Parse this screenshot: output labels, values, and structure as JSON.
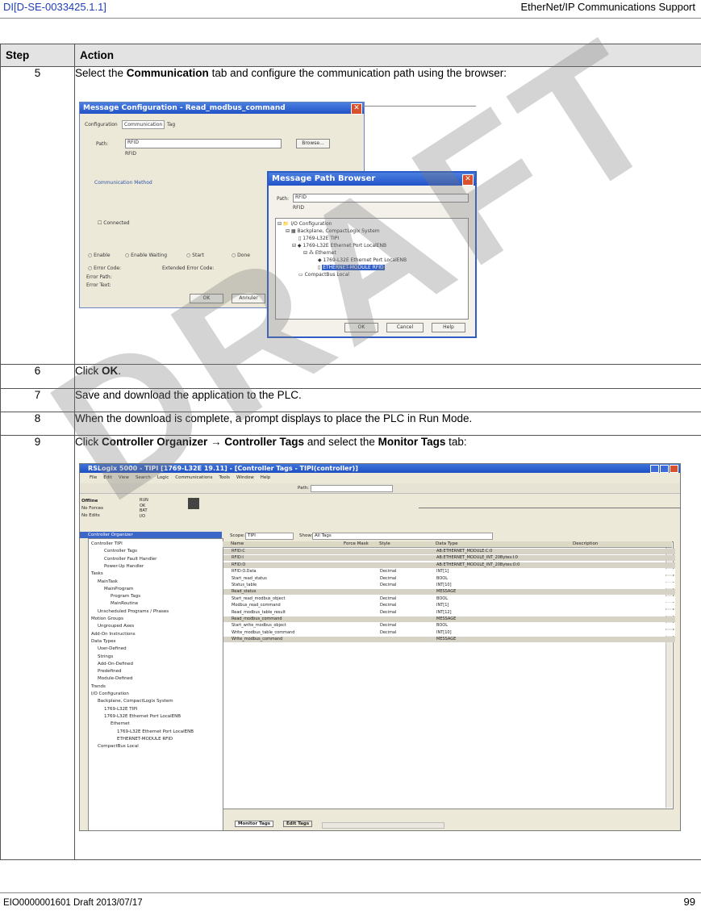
{
  "header": {
    "doc_id": "DI[D-SE-0033425.1.1]",
    "doc_title": "EtherNet/IP Communications Support"
  },
  "table": {
    "col_step": "Step",
    "col_action": "Action",
    "rows": [
      {
        "step": "5",
        "pre": "Select the ",
        "bold1": "Communication",
        "mid": " tab and configure the communication path using the browser:",
        "bold2": "",
        "post": "",
        "bold3": "",
        "post2": ""
      },
      {
        "step": "6",
        "pre": "Click ",
        "bold1": "OK",
        "mid": ".",
        "bold2": "",
        "post": "",
        "bold3": "",
        "post2": ""
      },
      {
        "step": "7",
        "pre": "Save and download the application to the PLC.",
        "bold1": "",
        "mid": "",
        "bold2": "",
        "post": "",
        "bold3": "",
        "post2": ""
      },
      {
        "step": "8",
        "pre": "When the download is complete, a prompt displays to place the PLC in Run Mode.",
        "bold1": "",
        "mid": "",
        "bold2": "",
        "post": "",
        "bold3": "",
        "post2": ""
      },
      {
        "step": "9",
        "pre": "Click ",
        "bold1": "Controller Organizer",
        "mid": " → ",
        "bold2": "Controller Tags",
        "post": " and select the ",
        "bold3": "Monitor Tags",
        "post2": " tab:"
      }
    ]
  },
  "msg_config": {
    "title": "Message Configuration - Read_modbus_command",
    "tabs": [
      "Configuration",
      "Communication",
      "Tag"
    ],
    "path_label": "Path:",
    "path_value": "RFID",
    "path_sub": "RFID",
    "browse": "Browse...",
    "comm_method": "Communication Method",
    "connected": "Connected",
    "status": [
      "Enable",
      "Enable Waiting",
      "Start",
      "Done"
    ],
    "error_code": "Error Code:",
    "extended_error": "Extended Error Code:",
    "error_path": "Error Path:",
    "error_text": "Error Text:",
    "ok": "OK",
    "annuler": "Annuler"
  },
  "path_browser": {
    "title": "Message Path Browser",
    "path_label": "Path:",
    "path_value": "RFID",
    "path_sub": "RFID",
    "tree": [
      "I/O Configuration",
      "Backplane, CompactLogix System",
      "1769-L32E TIPI",
      "1769-L32E Ethernet Port LocalENB",
      "Ethernet",
      "1769-L32E Ethernet Port LocalENB",
      "ETHERNET-MODULE RFID",
      "CompactBus Local"
    ],
    "ok": "OK",
    "cancel": "Cancel",
    "help": "Help"
  },
  "rslogix": {
    "title": "RSLogix 5000 - TIPI [1769-L32E 19.11] - [Controller Tags - TIPI(controller)]",
    "menu": [
      "File",
      "Edit",
      "View",
      "Search",
      "Logic",
      "Communications",
      "Tools",
      "Window",
      "Help"
    ],
    "status": [
      "Offline",
      "No Forces",
      "No Edits"
    ],
    "leds": [
      "RUN",
      "OK",
      "BAT",
      "I/O"
    ],
    "path_label": "Path:",
    "scope_label": "Scope:",
    "scope_value": "TIPI",
    "show_label": "Show:",
    "show_value": "All Tags",
    "organizer_title": "Controller Organizer",
    "tree": [
      "Controller TIPI",
      "Controller Tags",
      "Controller Fault Handler",
      "Power-Up Handler",
      "Tasks",
      "MainTask",
      "MainProgram",
      "Program Tags",
      "MainRoutine",
      "Unscheduled Programs / Phases",
      "Motion Groups",
      "Ungrouped Axes",
      "Add-On Instructions",
      "Data Types",
      "User-Defined",
      "Strings",
      "Add-On-Defined",
      "Predefined",
      "Module-Defined",
      "Trends",
      "I/O Configuration",
      "Backplane, CompactLogix System",
      "1769-L32E TIPI",
      "1769-L32E Ethernet Port LocalENB",
      "Ethernet",
      "1769-L32E Ethernet Port LocalENB",
      "ETHERNET-MODULE RFID",
      "CompactBus Local"
    ],
    "columns": [
      "Name",
      "Force Mask",
      "Style",
      "Data Type",
      "Description"
    ],
    "rows": [
      {
        "name": "RFID:C",
        "style": "",
        "type": "AB:ETHERNET_MODULE:C:0"
      },
      {
        "name": "RFID:I",
        "style": "",
        "type": "AB:ETHERNET_MODULE_INT_20Bytes:I:0"
      },
      {
        "name": "RFID:O",
        "style": "",
        "type": "AB:ETHERNET_MODULE_INT_20Bytes:O:0"
      },
      {
        "name": "RFID:O.Data",
        "style": "Decimal",
        "type": "INT[1]"
      },
      {
        "name": "Start_read_status",
        "style": "Decimal",
        "type": "BOOL"
      },
      {
        "name": "Status_table",
        "style": "Decimal",
        "type": "INT[10]"
      },
      {
        "name": "Read_status",
        "style": "",
        "type": "MESSAGE"
      },
      {
        "name": "Start_read_modbus_object",
        "style": "Decimal",
        "type": "BOOL"
      },
      {
        "name": "Modbus_read_command",
        "style": "Decimal",
        "type": "INT[1]"
      },
      {
        "name": "Read_modbus_table_result",
        "style": "Decimal",
        "type": "INT[12]"
      },
      {
        "name": "Read_modbus_command",
        "style": "",
        "type": "MESSAGE"
      },
      {
        "name": "Start_write_modbus_object",
        "style": "Decimal",
        "type": "BOOL"
      },
      {
        "name": "Write_modbus_table_command",
        "style": "Decimal",
        "type": "INT[10]"
      },
      {
        "name": "Write_modbus_command",
        "style": "",
        "type": "MESSAGE"
      }
    ],
    "tabs": [
      "Monitor Tags",
      "Edit Tags"
    ]
  },
  "watermark": "DRAFT",
  "footer": {
    "left": "EIO0000001601 Draft 2013/07/17",
    "page": "99"
  }
}
